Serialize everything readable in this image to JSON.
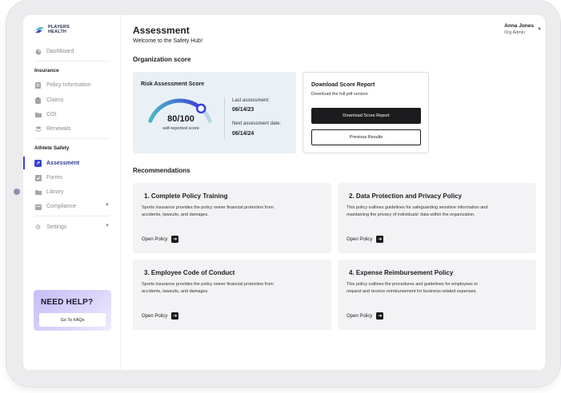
{
  "brand": {
    "line1": "PLAYERS",
    "line2": "HEALTH"
  },
  "sidebar": {
    "dashboard": "Dashboard",
    "insurance_section": "Insurance",
    "insurance_items": [
      "Policy Information",
      "Claims",
      "COI",
      "Renewals"
    ],
    "athlete_section": "Athlete Safety",
    "athlete_items": [
      "Assessment",
      "Forms",
      "Library",
      "Compliance"
    ],
    "settings": "Settings",
    "help_title": "NEED HELP?",
    "help_button": "Go To FAQs"
  },
  "header": {
    "title": "Assessment",
    "subtitle": "Welcome to the Safety Hub!",
    "user_name": "Anna Jones",
    "user_role": "Org Admin"
  },
  "org_score": {
    "heading": "Organization score",
    "card_title": "Risk Assessment Score",
    "score": "80/100",
    "score_fraction": 0.8,
    "score_caption": "self-reported score",
    "last_label": "Last assessment:",
    "last_value": "06/14/23",
    "next_label": "Next assessment date:",
    "next_value": "06/14/24"
  },
  "download": {
    "title": "Download Score Report",
    "subtitle": "Download the full pdf version",
    "primary_button": "Download Score Report",
    "secondary_button": "Previous Results"
  },
  "recommendations": {
    "heading": "Recommendations",
    "link_label": "Open Policy",
    "items": [
      {
        "title": "1. Complete Policy Training",
        "desc": "Sports insurance provides the policy owner financial protection from accidents, lawsuits, and damages."
      },
      {
        "title": "2. Data Protection and Privacy Policy",
        "desc": "This policy outlines guidelines for safeguarding sensitive information and maintaining the privacy of individuals' data within the organization."
      },
      {
        "title": "3. Employee Code of Conduct",
        "desc": "Sports insurance provides the policy owner financial protection from accidents, lawsuits, and damages."
      },
      {
        "title": "4. Expense Reimbursement Policy",
        "desc": "This policy outlines the procedures and guidelines for employees to request and receive reimbursement for business-related expenses."
      }
    ]
  },
  "colors": {
    "accent": "#3b3fd8",
    "score_card_bg": "#e9f1f7",
    "gauge_start": "#4db6c9",
    "gauge_end": "#3b3fd8"
  },
  "icons": {
    "dashboard": "pie-chart-icon",
    "policy": "document-icon",
    "claims": "clipboard-icon",
    "coi": "folder-icon",
    "renewals": "layers-icon",
    "assessment": "checkbox-icon",
    "forms": "form-icon",
    "library": "folder-icon",
    "compliance": "calendar-icon",
    "settings": "gear-icon",
    "open": "arrow-right-icon"
  }
}
